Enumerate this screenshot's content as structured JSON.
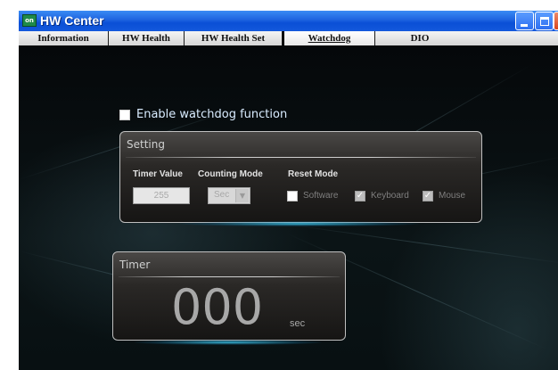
{
  "window": {
    "title": "HW Center",
    "app_icon_text": "on"
  },
  "tabs": [
    {
      "label": "Information"
    },
    {
      "label": "HW Health"
    },
    {
      "label": "HW Health Set"
    },
    {
      "label": "Watchdog",
      "selected": true
    },
    {
      "label": "DIO"
    }
  ],
  "watchdog": {
    "enable_label": "Enable watchdog function",
    "enable_checked": false
  },
  "setting": {
    "title": "Setting",
    "timer_value_label": "Timer Value",
    "counting_mode_label": "Counting Mode",
    "reset_mode_label": "Reset  Mode",
    "timer_value": "255",
    "counting_mode_value": "Sec",
    "reset_options": [
      {
        "label": "Software",
        "checked": false
      },
      {
        "label": "Keyboard",
        "checked": true
      },
      {
        "label": "Mouse",
        "checked": true
      }
    ]
  },
  "timer": {
    "title": "Timer",
    "value": "000",
    "unit": "sec"
  },
  "colors": {
    "titlebar_blue": "#0a4fd6",
    "background": "#05080a",
    "panel_border": "#bfbfbf",
    "accent_glow": "#3cc8f0",
    "enable_text": "#d9ecff"
  }
}
